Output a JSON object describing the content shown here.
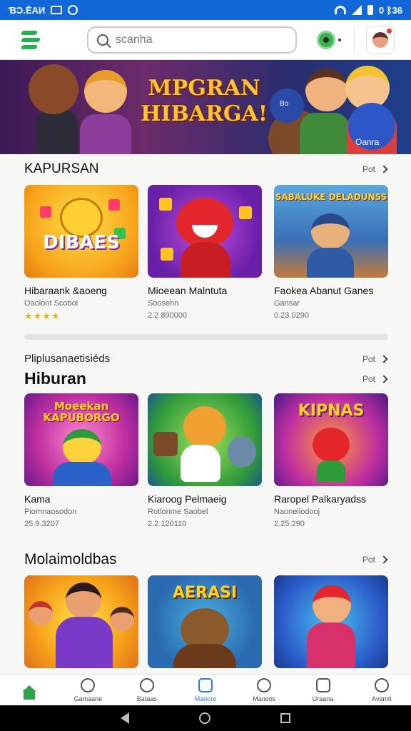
{
  "status_bar": {
    "left_text": "ƁƆ.ĒAИ",
    "right_text": "0 ᛒ36"
  },
  "header": {
    "search_placeholder": "scanha"
  },
  "banner": {
    "title": "MPGRAN HIBARGA!",
    "ball_label": "Oanra",
    "ball_label_small": "Bo"
  },
  "sections": [
    {
      "title": "KAPURSAN",
      "more": "Pot",
      "cards": [
        {
          "thumb_label": "DIBAES",
          "title": "Hibaraank &aoeng",
          "subtitle": "Oaolont Scobol",
          "rating": "★★★★",
          "rating_value": 4
        },
        {
          "thumb_label": "",
          "title": "Mioeean Malntuta",
          "subtitle": "Soosehn",
          "meta": "2.2 890000"
        },
        {
          "thumb_label": "SABALUKE DELADUNSS",
          "title": "Faokea Abanut Ganes",
          "subtitle": "Gansar",
          "meta": "0.23.0290"
        }
      ]
    },
    {
      "title": "Hiburan",
      "eyebrow": "Pliplusanaetisiéds",
      "more": "Pot",
      "more_eyebrow": "Pot",
      "cards": [
        {
          "thumb_label": "Moeekan KAPUBORGO",
          "title": "Kama",
          "subtitle": "Piomnaosodon",
          "meta": "25.9.3207"
        },
        {
          "thumb_label": "",
          "title": "Kiaroog Pelmaeig",
          "subtitle": "Rotlonme Saobel",
          "meta": "2.2.120110"
        },
        {
          "thumb_label": "KIPNAS",
          "title": "Raropel Palkaryadss",
          "subtitle": "Naoneilodooj",
          "meta": "2.25.290"
        }
      ]
    },
    {
      "title": "Molaimoldbas",
      "more": "Pot",
      "cards": [
        {
          "thumb_label": ""
        },
        {
          "thumb_label": "AERASI"
        },
        {
          "thumb_label": ""
        }
      ]
    }
  ],
  "bottom_nav": [
    {
      "label": "",
      "icon": "home-icon",
      "active": false
    },
    {
      "label": "Gamaane",
      "icon": "compass-icon",
      "active": false
    },
    {
      "label": "Bataas",
      "icon": "chat-icon",
      "active": false
    },
    {
      "label": "Maoore",
      "icon": "grid-icon",
      "active": true
    },
    {
      "label": "Manoos",
      "icon": "person-icon",
      "active": false
    },
    {
      "label": "Uraana",
      "icon": "gamepad-icon",
      "active": false
    },
    {
      "label": "Avamit",
      "icon": "profile-icon",
      "active": false
    }
  ]
}
